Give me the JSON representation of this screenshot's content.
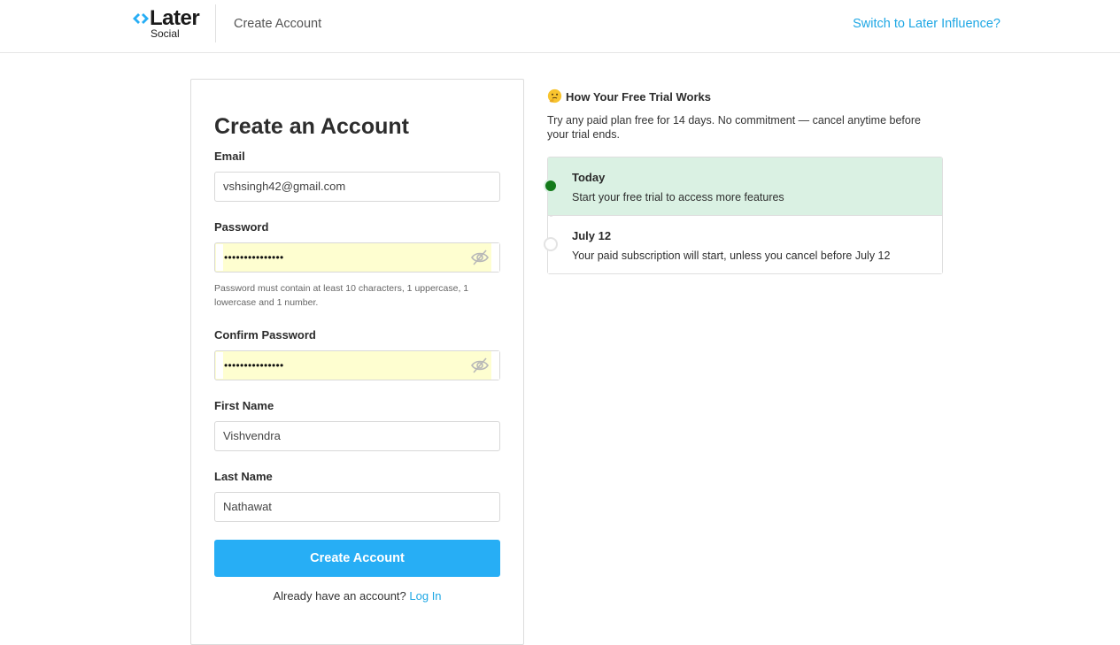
{
  "header": {
    "logo_word": "Later",
    "logo_sub": "Social",
    "title": "Create Account",
    "switch_link": "Switch to Later Influence?"
  },
  "form": {
    "title": "Create an Account",
    "email": {
      "label": "Email",
      "value": "vshsingh42@gmail.com"
    },
    "password": {
      "label": "Password",
      "masked_value": "•••••••••••••••",
      "toggle_icon": "eye-slash-icon"
    },
    "password_hint": "Password must contain at least 10 characters, 1 uppercase, 1 lowercase and 1 number.",
    "confirm_password": {
      "label": "Confirm Password",
      "masked_value": "•••••••••••••••",
      "toggle_icon": "eye-slash-icon"
    },
    "first_name": {
      "label": "First Name",
      "value": "Vishvendra"
    },
    "last_name": {
      "label": "Last Name",
      "value": "Nathawat"
    },
    "submit_label": "Create Account",
    "login_prompt": "Already have an account?",
    "login_link": "Log In"
  },
  "trial": {
    "emoji_icon": "thinking-face-icon",
    "heading": "How Your Free Trial Works",
    "description": "Try any paid plan free for 14 days. No commitment — cancel anytime before your trial ends.",
    "steps": [
      {
        "title": "Today",
        "text": "Start your free trial to access more features",
        "active": true
      },
      {
        "title": "July 12",
        "text": "Your paid subscription will start, unless you cancel before July 12",
        "active": false
      }
    ]
  },
  "colors": {
    "accent": "#27aef5",
    "link": "#1ea7e4",
    "autofill": "#fefed0",
    "active_step_bg": "#daf1e3",
    "active_dot": "#137a1a"
  }
}
